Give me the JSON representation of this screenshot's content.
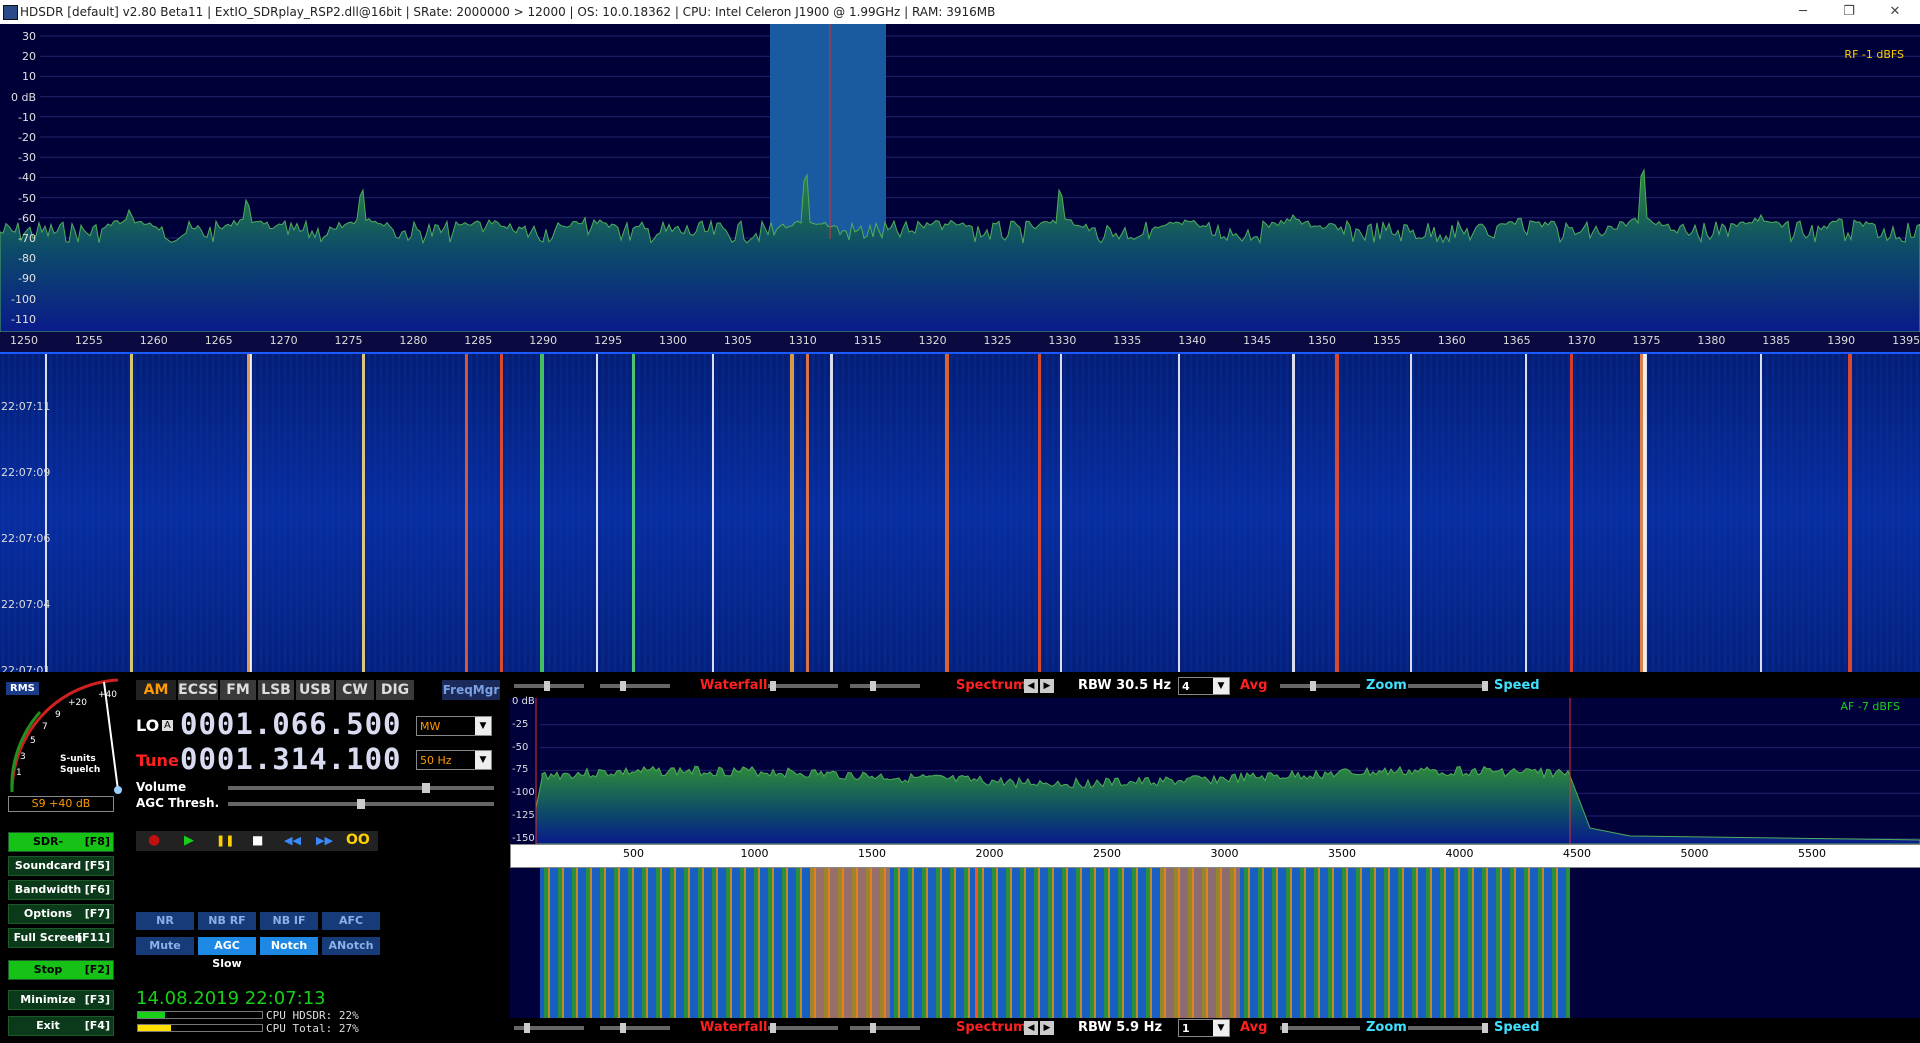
{
  "window": {
    "title": "HDSDR  [default]  v2.80 Beta11  |  ExtIO_SDRplay_RSP2.dll@16bit  |  SRate: 2000000 > 12000  |  OS: 10.0.18362   |  CPU: Intel Celeron  J1900  @ 1.99GHz  |  RAM: 3916MB",
    "minimize": "─",
    "restore": "❐",
    "close": "✕"
  },
  "rf": {
    "level": "RF  -1 dBFS",
    "db_labels": [
      "30",
      "20",
      "10",
      "0 dB",
      "-10",
      "-20",
      "-30",
      "-40",
      "-50",
      "-60",
      "-70",
      "-80",
      "-90",
      "-100",
      "-110"
    ],
    "freq_labels": [
      "1250",
      "1255",
      "1260",
      "1265",
      "1270",
      "1275",
      "1280",
      "1285",
      "1290",
      "1295",
      "1300",
      "1305",
      "1310",
      "1315",
      "1320",
      "1325",
      "1330",
      "1335",
      "1340",
      "1345",
      "1350",
      "1355",
      "1360",
      "1365",
      "1370",
      "1375",
      "1380",
      "1385",
      "1390",
      "1395"
    ],
    "waterfall_times": [
      "22:07:11",
      "22:07:09",
      "22:07:06",
      "22:07:04",
      "22:07:01"
    ]
  },
  "smeter": {
    "mode": "RMS",
    "scale_labels": [
      "1",
      "3",
      "5",
      "7",
      "9",
      "+20",
      "+40"
    ],
    "caption1": "S-units",
    "caption2": "Squelch",
    "reading": "S9 +40 dB"
  },
  "modes": [
    "AM",
    "ECSS",
    "FM",
    "LSB",
    "USB",
    "CW",
    "DIG"
  ],
  "active_mode": "AM",
  "freqmgr": "FreqMgr",
  "lo": {
    "label": "LO",
    "sub": "A",
    "value": "0001.066.500",
    "band": "MW"
  },
  "tune": {
    "label": "Tune",
    "value": "0001.314.100",
    "step": "50 Hz"
  },
  "volume_label": "Volume",
  "agc_thresh_label": "AGC Thresh.",
  "volume_level": 0.75,
  "agc_level": 0.5,
  "side_buttons": [
    {
      "label": "SDR-Device",
      "key": "[F8]",
      "on": true
    },
    {
      "label": "Soundcard",
      "key": "[F5]",
      "on": false
    },
    {
      "label": "Bandwidth",
      "key": "[F6]",
      "on": false
    },
    {
      "label": "Options",
      "key": "[F7]",
      "on": false
    },
    {
      "label": "Full Screen",
      "key": "[F11]",
      "on": false
    },
    {
      "label": "Stop",
      "key": "[F2]",
      "on": true
    },
    {
      "label": "Minimize",
      "key": "[F3]",
      "on": false
    },
    {
      "label": "Exit",
      "key": "[F4]",
      "on": false
    }
  ],
  "transport": {
    "record": "●",
    "play": "▶",
    "pause": "❚❚",
    "stop": "■",
    "rewind": "◀◀",
    "forward": "▶▶",
    "loop": "OO"
  },
  "dsp_row1": [
    {
      "label": "NR",
      "on": false
    },
    {
      "label": "NB RF",
      "on": false
    },
    {
      "label": "NB IF",
      "on": false
    },
    {
      "label": "AFC",
      "on": false
    }
  ],
  "dsp_row2": [
    {
      "label": "Mute",
      "on": false
    },
    {
      "label": "AGC Slow",
      "on": true
    },
    {
      "label": "Notch",
      "on": true
    },
    {
      "label": "ANotch",
      "on": false
    }
  ],
  "datetime": "14.08.2019 22:07:13",
  "cpu_hdsdr": "CPU HDSDR: 22%",
  "cpu_total": "CPU Total: 27%",
  "cpu_hdsdr_value": 0.22,
  "cpu_total_value": 0.27,
  "rf_bar": {
    "waterfall": "Waterfall",
    "spectrum": "Spectrum",
    "rbw": "RBW 30.5 Hz",
    "avg_value": "4",
    "avg": "Avg",
    "zoom": "Zoom",
    "speed": "Speed"
  },
  "af_bar": {
    "waterfall": "Waterfall",
    "spectrum": "Spectrum",
    "rbw": "RBW  5.9 Hz",
    "avg_value": "1",
    "avg": "Avg",
    "zoom": "Zoom",
    "speed": "Speed"
  },
  "af": {
    "level": "AF  -7 dBFS",
    "db_labels": [
      "0 dB",
      "-25",
      "-50",
      "-75",
      "-100",
      "-125",
      "-150"
    ],
    "freq_labels": [
      "500",
      "1000",
      "1500",
      "2000",
      "2500",
      "3000",
      "3500",
      "4000",
      "4500",
      "5000",
      "5500"
    ]
  },
  "colors": {
    "accent_orange": "#ff9a00",
    "button_green": "#17c217",
    "button_blue": "#1e88e5",
    "red_label": "#ff2020",
    "cyan_label": "#40e0ff"
  }
}
